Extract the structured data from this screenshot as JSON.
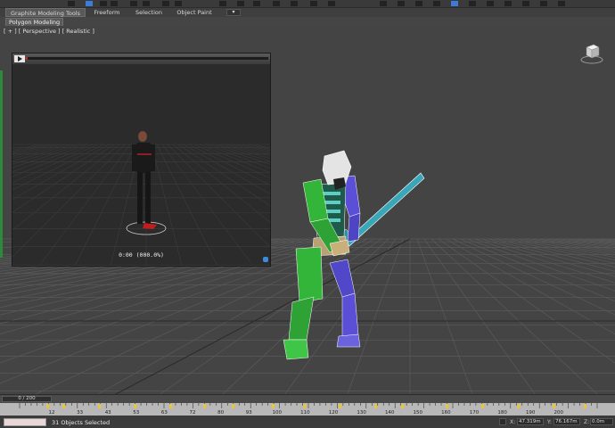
{
  "ribbon": {
    "tabs": [
      {
        "label": "Graphite Modeling Tools",
        "active": true
      },
      {
        "label": "Freeform",
        "active": false
      },
      {
        "label": "Selection",
        "active": false
      },
      {
        "label": "Object Paint",
        "active": false
      }
    ],
    "more_glyph": "▾",
    "panel_button": "Polygon Modeling"
  },
  "viewport": {
    "label": "[ + ] [ Perspective ] [ Realistic ]",
    "viewcube_icon": "viewcube-icon"
  },
  "player": {
    "time_text": "0:00 (000.0%)",
    "play_icon": "play-icon"
  },
  "timeline": {
    "slider_text": "0 / 200",
    "frame_labels": [
      "12",
      "33",
      "43",
      "53",
      "63",
      "72",
      "80",
      "93",
      "100",
      "110",
      "120",
      "130",
      "140",
      "150",
      "160",
      "170",
      "180",
      "190",
      "200"
    ],
    "status_text": "31 Objects Selected",
    "x_label": "X:",
    "x_value": "47.319m",
    "y_label": "Y:",
    "y_value": "76.167m",
    "z_label": "Z:",
    "z_value": "0.0m"
  },
  "colors": {
    "accent": "#3d7bd6",
    "char_green": "#33b53a",
    "char_purple": "#5a4fd6",
    "sword": "#3aa7b8"
  }
}
